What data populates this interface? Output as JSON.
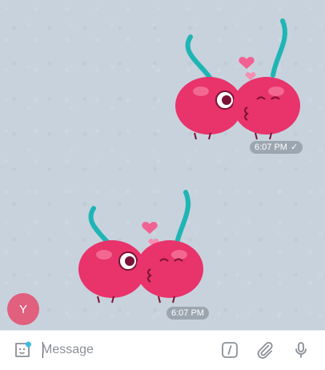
{
  "messages": [
    {
      "time": "6:07 PM",
      "read": true,
      "sticker": "kissing-cherries"
    },
    {
      "time": "6:07 PM",
      "read": false,
      "sticker": "kissing-cherries"
    }
  ],
  "avatar": {
    "initial": "Y",
    "color": "#e0607e"
  },
  "composer": {
    "placeholder": "Message",
    "icons": [
      "sticker-icon",
      "bot-command-icon",
      "attach-icon",
      "microphone-icon"
    ]
  },
  "colors": {
    "chat_background": "#c8d2dd",
    "cherry": "#e8336b",
    "stem": "#1fb5b5",
    "heart": "#f06292",
    "accent": "#3ebde0"
  }
}
